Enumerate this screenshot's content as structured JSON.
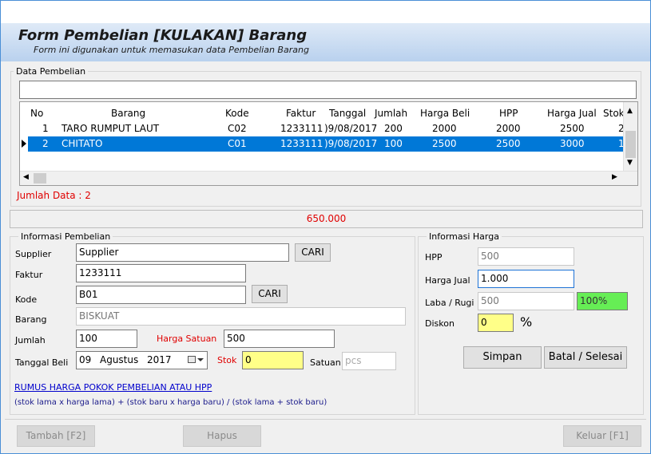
{
  "header": {
    "title": "Form Pembelian [KULAKAN] Barang",
    "subtitle": "Form ini digunakan untuk memasukan data  Pembelian Barang"
  },
  "data_pembelian": {
    "group_label": "Data Pembelian",
    "grid_columns": [
      "No",
      "Barang",
      "Kode",
      "Faktur",
      "Tanggal",
      "Jumlah",
      "Harga Beli",
      "HPP",
      "Harga Jual",
      "Stok"
    ],
    "rows": [
      {
        "no": "1",
        "barang": "TARO RUMPUT LAUT",
        "kode": "C02",
        "faktur": "1233111",
        "tanggal": ")9/08/2017",
        "jumlah": "200",
        "harga_beli": "2000",
        "hpp": "2000",
        "harga_jual": "2500",
        "stok": "2"
      },
      {
        "no": "2",
        "barang": "CHITATO",
        "kode": "C01",
        "faktur": "1233111",
        "tanggal": ")9/08/2017",
        "jumlah": "100",
        "harga_beli": "2500",
        "hpp": "2500",
        "harga_jual": "3000",
        "stok": "1"
      }
    ],
    "jumlah_data": "Jumlah Data : 2"
  },
  "total": "650.000",
  "informasi_pembelian": {
    "group_label": "Informasi Pembelian",
    "supplier_label": "Supplier",
    "supplier_value": "Supplier",
    "cari_label": "CARI",
    "faktur_label": "Faktur",
    "faktur_value": "1233111",
    "kode_label": "Kode",
    "kode_value": "B01",
    "barang_label": "Barang",
    "barang_value": "BISKUAT",
    "jumlah_label": "Jumlah",
    "jumlah_value": "100",
    "harga_satuan_label": "Harga Satuan",
    "harga_satuan_value": "500",
    "tanggal_label": "Tanggal Beli",
    "tanggal_day": "09",
    "tanggal_month": "Agustus",
    "tanggal_year": "2017",
    "stok_label": "Stok",
    "stok_value": "0",
    "satuan_label": "Satuan",
    "satuan_placeholder": "pcs",
    "rumus_link": "RUMUS HARGA POKOK PEMBELIAN ATAU HPP",
    "rumus_text": "(stok lama x harga lama) + (stok baru x harga baru) / (stok lama + stok baru)"
  },
  "informasi_harga": {
    "group_label": "Informasi Harga",
    "hpp_label": "HPP",
    "hpp_value": "500",
    "harga_jual_label": "Harga Jual",
    "harga_jual_value": "1.000",
    "laba_label": "Laba / Rugi",
    "laba_value": "500",
    "laba_percent": "100%",
    "diskon_label": "Diskon",
    "diskon_value": "0",
    "percent_sign": "%",
    "simpan_label": "Simpan",
    "batal_label": "Batal / Selesai"
  },
  "footer": {
    "tambah_label": "Tambah [F2]",
    "hapus_label": "Hapus",
    "keluar_label": "Keluar [F1]"
  },
  "colors": {
    "selection": "#0078d7",
    "header_gradient_top": "#dfeaf7",
    "header_gradient_bottom": "#b9d1ee",
    "warning_red": "#e00000",
    "highlight_yellow": "#ffff88",
    "profit_green": "#66ee55",
    "link_blue": "#0000cc"
  },
  "icons": [
    "scroll-up-icon",
    "scroll-down-icon",
    "scroll-left-icon",
    "scroll-right-icon",
    "row-pointer-icon",
    "calendar-icon"
  ]
}
